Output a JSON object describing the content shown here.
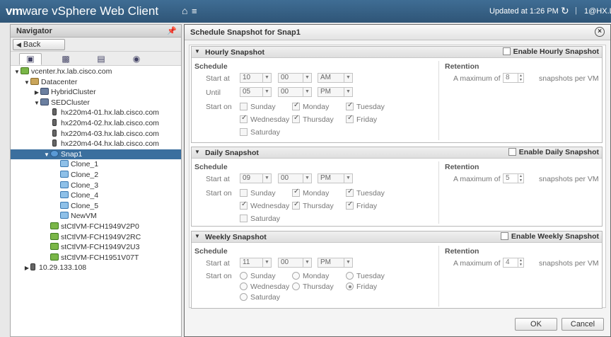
{
  "header": {
    "brand_vm": "vm",
    "brand_ware": "ware",
    "brand_rest": " vSphere Web Client",
    "updated": "Updated at 1:26 PM",
    "separator": "|",
    "user": "1@HX.L"
  },
  "navigator": {
    "title": "Navigator",
    "back_label": "Back",
    "tree": [
      {
        "label": "vcenter.hx.lab.cisco.com",
        "level": 0,
        "icon": "vcenter-icon",
        "twisty": "down"
      },
      {
        "label": "Datacenter",
        "level": 1,
        "icon": "datacenter-icon",
        "twisty": "down"
      },
      {
        "label": "HybridCluster",
        "level": 2,
        "icon": "cluster-icon",
        "twisty": "right"
      },
      {
        "label": "SEDCluster",
        "level": 2,
        "icon": "cluster-icon",
        "twisty": "down"
      },
      {
        "label": "hx220m4-01.hx.lab.cisco.com",
        "level": 3,
        "icon": "host-icon",
        "twisty": "none"
      },
      {
        "label": "hx220m4-02.hx.lab.cisco.com",
        "level": 3,
        "icon": "host-icon",
        "twisty": "none"
      },
      {
        "label": "hx220m4-03.hx.lab.cisco.com",
        "level": 3,
        "icon": "host-icon",
        "twisty": "none"
      },
      {
        "label": "hx220m4-04.hx.lab.cisco.com",
        "level": 3,
        "icon": "host-icon",
        "twisty": "none"
      },
      {
        "label": "Snap1",
        "level": 3,
        "icon": "snapshot-icon",
        "twisty": "down",
        "selected": true
      },
      {
        "label": "Clone_1",
        "level": 4,
        "icon": "vm-icon",
        "twisty": "none"
      },
      {
        "label": "Clone_2",
        "level": 4,
        "icon": "vm-icon",
        "twisty": "none"
      },
      {
        "label": "Clone_3",
        "level": 4,
        "icon": "vm-icon",
        "twisty": "none"
      },
      {
        "label": "Clone_4",
        "level": 4,
        "icon": "vm-icon",
        "twisty": "none"
      },
      {
        "label": "Clone_5",
        "level": 4,
        "icon": "vm-icon",
        "twisty": "none"
      },
      {
        "label": "NewVM",
        "level": 4,
        "icon": "vm-icon",
        "twisty": "none"
      },
      {
        "label": "stCtlVM-FCH1949V2P0",
        "level": 3,
        "icon": "controller-vm-icon",
        "twisty": "none"
      },
      {
        "label": "stCtlVM-FCH1949V2RC",
        "level": 3,
        "icon": "controller-vm-icon",
        "twisty": "none"
      },
      {
        "label": "stCtlVM-FCH1949V2U3",
        "level": 3,
        "icon": "controller-vm-icon",
        "twisty": "none"
      },
      {
        "label": "stCtlVM-FCH1951V07T",
        "level": 3,
        "icon": "controller-vm-icon",
        "twisty": "none"
      },
      {
        "label": "10.29.133.108",
        "level": 1,
        "icon": "host-icon",
        "twisty": "right"
      }
    ]
  },
  "dialog": {
    "title": "Schedule Snapshot for Snap1",
    "labels": {
      "schedule": "Schedule",
      "retention": "Retention",
      "start_at": "Start at",
      "until": "Until",
      "start_on": "Start on",
      "a_maximum_of": "A maximum of",
      "snapshots_per_vm": "snapshots per VM"
    },
    "days": [
      "Sunday",
      "Monday",
      "Tuesday",
      "Wednesday",
      "Thursday",
      "Friday",
      "Saturday"
    ],
    "hourly": {
      "title": "Hourly Snapshot",
      "enable_label": "Enable Hourly Snapshot",
      "enabled": false,
      "start": {
        "hour": "10",
        "minute": "00",
        "ampm": "AM"
      },
      "until": {
        "hour": "05",
        "minute": "00",
        "ampm": "PM"
      },
      "days_checked": [
        false,
        true,
        true,
        true,
        true,
        true,
        false
      ],
      "max": "8"
    },
    "daily": {
      "title": "Daily Snapshot",
      "enable_label": "Enable Daily Snapshot",
      "enabled": false,
      "start": {
        "hour": "09",
        "minute": "00",
        "ampm": "PM"
      },
      "days_checked": [
        false,
        true,
        true,
        true,
        true,
        true,
        false
      ],
      "max": "5"
    },
    "weekly": {
      "title": "Weekly Snapshot",
      "enable_label": "Enable Weekly Snapshot",
      "enabled": false,
      "start": {
        "hour": "11",
        "minute": "00",
        "ampm": "PM"
      },
      "selected_day": "Friday",
      "max": "4"
    },
    "ok_label": "OK",
    "cancel_label": "Cancel"
  }
}
